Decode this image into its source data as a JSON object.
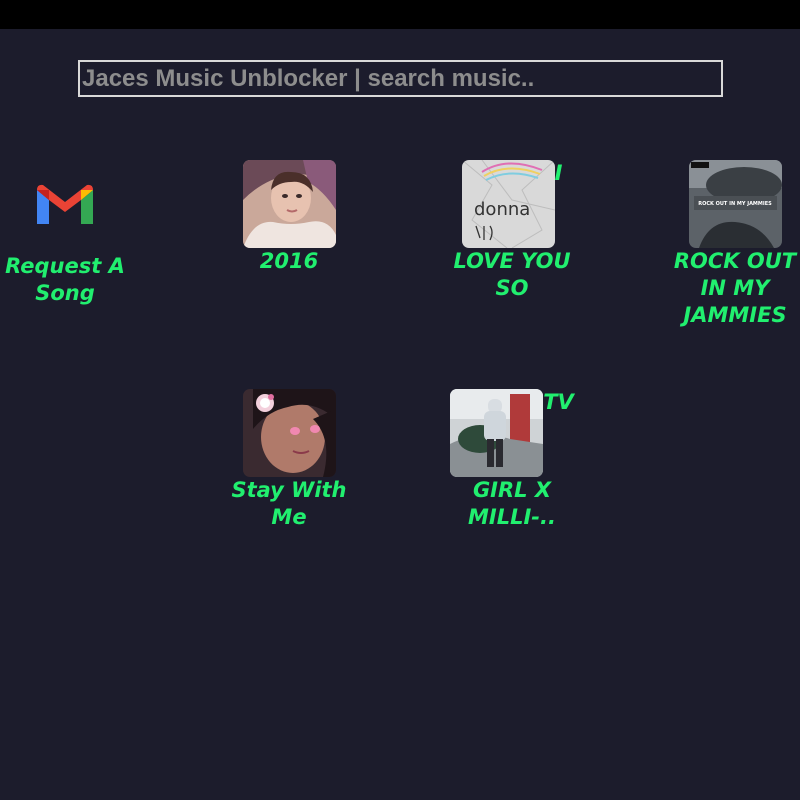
{
  "search": {
    "placeholder": "Jaces Music Unblocker | search music.."
  },
  "tiles": [
    {
      "title": "Request A Song",
      "icon": "gmail-icon"
    },
    {
      "title": "2016"
    },
    {
      "title": "I LOVE YOU SO"
    },
    {
      "title": "ROCK OUT IN MY JAMMIES"
    },
    {
      "title": "Stay With Me"
    },
    {
      "title": "TV GIRL X MILLI-.."
    }
  ],
  "colors": {
    "background": "#1c1c2c",
    "accent": "#21ef6f",
    "topbar": "#000000"
  }
}
